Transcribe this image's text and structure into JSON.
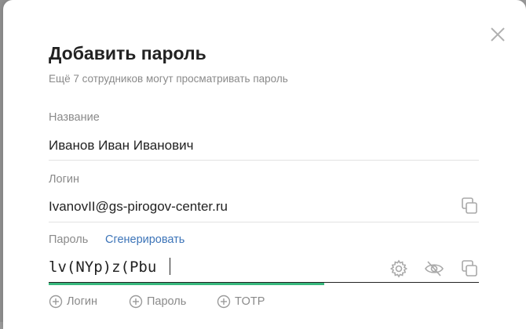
{
  "dialog": {
    "title": "Добавить пароль",
    "subtitle": "Ещё 7 сотрудников могут просматривать пароль",
    "close_icon": "close-icon"
  },
  "fields": {
    "name": {
      "label": "Название",
      "value": "Иванов Иван Иванович"
    },
    "login": {
      "label": "Логин",
      "value": "IvanovII@gs-pirogov-center.ru",
      "copy_icon": "copy-icon"
    },
    "password": {
      "label": "Пароль",
      "generate_link": "Сгенерировать",
      "value": "lv(NYp)z(Pbu",
      "strength": 0.64,
      "strength_color": "#38b87d",
      "icons": [
        "gear-icon",
        "eye-off-icon",
        "copy-icon"
      ]
    }
  },
  "add_buttons": [
    {
      "label": "Логин",
      "icon": "plus-circle-icon"
    },
    {
      "label": "Пароль",
      "icon": "plus-circle-icon"
    },
    {
      "label": "TOTP",
      "icon": "plus-circle-icon"
    }
  ],
  "colors": {
    "accent_link": "#3c74b8",
    "muted_text": "#8a8a8a",
    "backdrop": "#9a9a9a"
  }
}
